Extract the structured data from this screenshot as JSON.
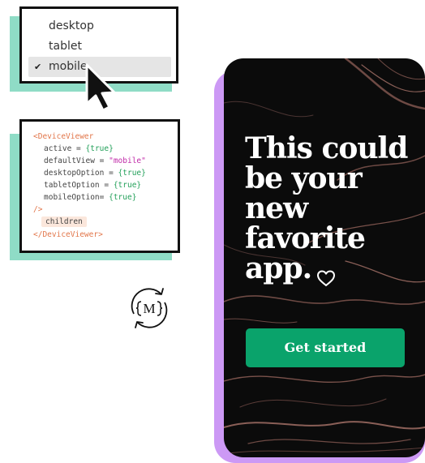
{
  "view_selector": {
    "options": [
      {
        "label": "desktop",
        "selected": false
      },
      {
        "label": "tablet",
        "selected": false
      },
      {
        "label": "mobile",
        "selected": true
      }
    ],
    "check_glyph": "✔"
  },
  "code": {
    "open_tag": "<DeviceViewer",
    "props": [
      {
        "name": "active",
        "eq": " = ",
        "value": "{true}",
        "kind": "val"
      },
      {
        "name": "defaultView",
        "eq": " = ",
        "value": "\"mobile\"",
        "kind": "str"
      },
      {
        "name": "desktopOption",
        "eq": " = ",
        "value": "{true}",
        "kind": "val"
      },
      {
        "name": "tabletOption",
        "eq": " = ",
        "value": "{true}",
        "kind": "val"
      },
      {
        "name": "mobileOption",
        "eq": "= ",
        "value": "{true}",
        "kind": "val"
      }
    ],
    "self_close": "/>",
    "children": "children",
    "close_tag": "</DeviceViewer>"
  },
  "logo": {
    "letter": "M",
    "icon": "sync-logo-icon"
  },
  "phone": {
    "headline_lines": [
      "This could",
      "be your",
      "new",
      "favorite",
      "app."
    ],
    "heart_icon": "heart-outline-icon",
    "cta_label": "Get started"
  },
  "colors": {
    "accent_green": "#0aa36b",
    "shadow_mint": "#8fdcc6",
    "shadow_lavender": "#cc99f5",
    "code_tag": "#e2764a",
    "code_value": "#23a05a",
    "code_string": "#c02aa8"
  }
}
